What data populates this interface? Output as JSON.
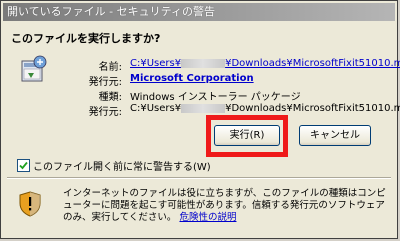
{
  "window": {
    "title": "開いているファイル - セキュリティの警告"
  },
  "prompt": {
    "question": "このファイルを実行しますか?"
  },
  "file_info": {
    "name_label": "名前:",
    "name_prefix": "C:¥Users¥",
    "name_suffix": "¥Downloads¥MicrosoftFixit51010.msi",
    "publisher_label": "発行元:",
    "publisher_value": "Microsoft Corporation",
    "type_label": "種類:",
    "type_value": "Windows インストーラー パッケージ",
    "from_label": "発行元:",
    "from_prefix": "C:¥Users¥",
    "from_suffix": "¥Downloads¥MicrosoftFixit51010.msi"
  },
  "buttons": {
    "run_label": "実行(R)",
    "cancel_label": "キャンセル"
  },
  "checkbox": {
    "label": "このファイル開く前に常に警告する(W)",
    "checked": true
  },
  "warning": {
    "text": "インターネットのファイルは役に立ちますが、このファイルの種類はコンピューターに問題を起こす可能性があります。信頼する発行元のソフトウェアのみ、実行してください。",
    "link": "危険性の説明"
  },
  "colors": {
    "highlight": "#ef1a1a",
    "link": "#0000cc"
  }
}
